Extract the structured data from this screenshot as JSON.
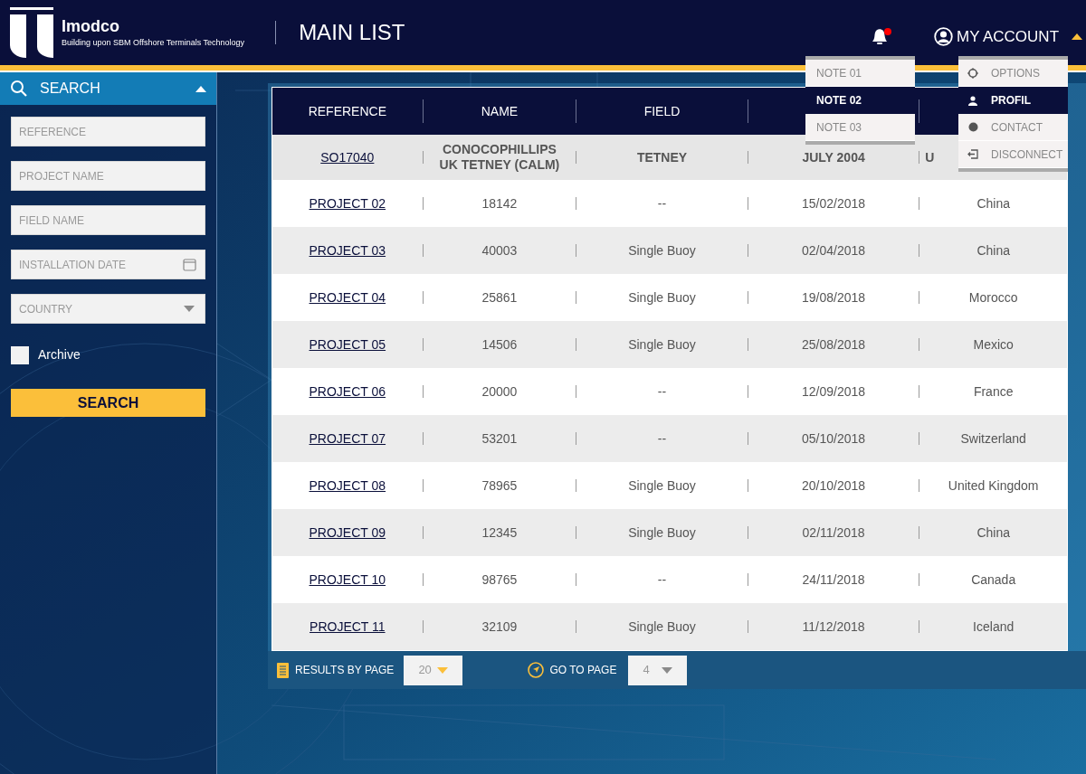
{
  "header": {
    "brand": "Imodco",
    "tagline": "Building upon SBM Offshore Terminals Technology",
    "title": "MAIN LIST",
    "notifications": {
      "unread": true
    },
    "account": {
      "label": "MY ACCOUNT",
      "expanded": true
    }
  },
  "notes_menu": [
    {
      "label": "NOTE 01",
      "selected": false
    },
    {
      "label": "NOTE 02",
      "selected": true
    },
    {
      "label": "NOTE 03",
      "selected": false
    }
  ],
  "account_menu": [
    {
      "label": "OPTIONS",
      "kind": "options",
      "selected": false
    },
    {
      "label": "PROFIL",
      "kind": "profile",
      "selected": true
    },
    {
      "label": "CONTACT",
      "kind": "contact",
      "selected": false
    },
    {
      "label": "DISCONNECT",
      "kind": "disconnect",
      "selected": false
    }
  ],
  "search_panel": {
    "title": "SEARCH",
    "expanded": true,
    "fields": [
      {
        "placeholder": "REFERENCE",
        "kind": "text"
      },
      {
        "placeholder": "PROJECT NAME",
        "kind": "text"
      },
      {
        "placeholder": "FIELD NAME",
        "kind": "text"
      },
      {
        "placeholder": "INSTALLATION DATE",
        "kind": "date"
      },
      {
        "placeholder": "COUNTRY",
        "kind": "select"
      }
    ],
    "archive": {
      "label": "Archive",
      "checked": false
    },
    "button": "SEARCH"
  },
  "table": {
    "columns": [
      "REFERENCE",
      "NAME",
      "FIELD"
    ],
    "rows": [
      {
        "kind": "featured",
        "cells": [
          "SO17040",
          "CONOCOPHILLIPS UK TETNEY (CALM)",
          "TETNEY",
          "JULY 2004",
          "U"
        ]
      },
      {
        "kind": "normal",
        "cells": [
          "PROJECT 02",
          "18142",
          "--",
          "15/02/2018",
          "China"
        ]
      },
      {
        "kind": "normal",
        "cells": [
          "PROJECT 03",
          "40003",
          "Single Buoy",
          "02/04/2018",
          "China"
        ]
      },
      {
        "kind": "normal",
        "cells": [
          "PROJECT 04",
          "25861",
          "Single Buoy",
          "19/08/2018",
          "Morocco"
        ]
      },
      {
        "kind": "normal",
        "cells": [
          "PROJECT 05",
          "14506",
          "Single Buoy",
          "25/08/2018",
          "Mexico"
        ]
      },
      {
        "kind": "normal",
        "cells": [
          "PROJECT 06",
          "20000",
          "--",
          "12/09/2018",
          "France"
        ]
      },
      {
        "kind": "normal",
        "cells": [
          "PROJECT 07",
          "53201",
          "--",
          "05/10/2018",
          "Switzerland"
        ]
      },
      {
        "kind": "normal",
        "cells": [
          "PROJECT 08",
          "78965",
          "Single Buoy",
          "20/10/2018",
          "United Kingdom"
        ]
      },
      {
        "kind": "normal",
        "cells": [
          "PROJECT 09",
          "12345",
          "Single Buoy",
          "02/11/2018",
          "China"
        ]
      },
      {
        "kind": "normal",
        "cells": [
          "PROJECT 10",
          "98765",
          "--",
          "24/11/2018",
          "Canada"
        ]
      },
      {
        "kind": "normal",
        "cells": [
          "PROJECT 11",
          "32109",
          "Single Buoy",
          "11/12/2018",
          "Iceland"
        ]
      }
    ]
  },
  "pagination": {
    "results_label": "RESULTS BY PAGE",
    "results_value": "20",
    "goto_label": "GO TO PAGE",
    "goto_value": "4"
  }
}
